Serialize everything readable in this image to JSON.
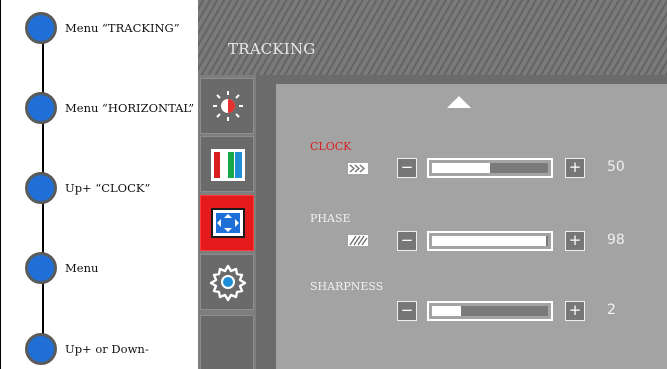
{
  "steps": [
    {
      "label": "Menu  “TRACKING”"
    },
    {
      "label": "Menu  “HORIZONTAL”"
    },
    {
      "label": "Up+  “CLOCK”"
    },
    {
      "label": "Menu"
    },
    {
      "label": "Up+ or Down-"
    }
  ],
  "osd": {
    "title": "TRACKING",
    "tabs": [
      {
        "icon": "brightness-icon",
        "active": false
      },
      {
        "icon": "color-bars-icon",
        "active": false
      },
      {
        "icon": "screen-position-icon",
        "active": true
      },
      {
        "icon": "gear-icon",
        "active": false
      },
      {
        "icon": "blank-tab",
        "active": false
      }
    ],
    "settings": [
      {
        "label": "CLOCK",
        "active": true,
        "value": "50",
        "level": 0.5,
        "icon": "clock-pattern-icon"
      },
      {
        "label": "PHASE",
        "active": false,
        "value": "98",
        "level": 0.98,
        "icon": "phase-pattern-icon"
      },
      {
        "label": "SHARPNESS",
        "active": false,
        "value": "2",
        "level": 0.25,
        "icon": ""
      }
    ],
    "minus_symbol": "−",
    "plus_symbol": "+"
  },
  "colors": {
    "step_dot": "#1f6fd6",
    "active_tab": "#e51b1b",
    "active_label": "#d82020"
  }
}
